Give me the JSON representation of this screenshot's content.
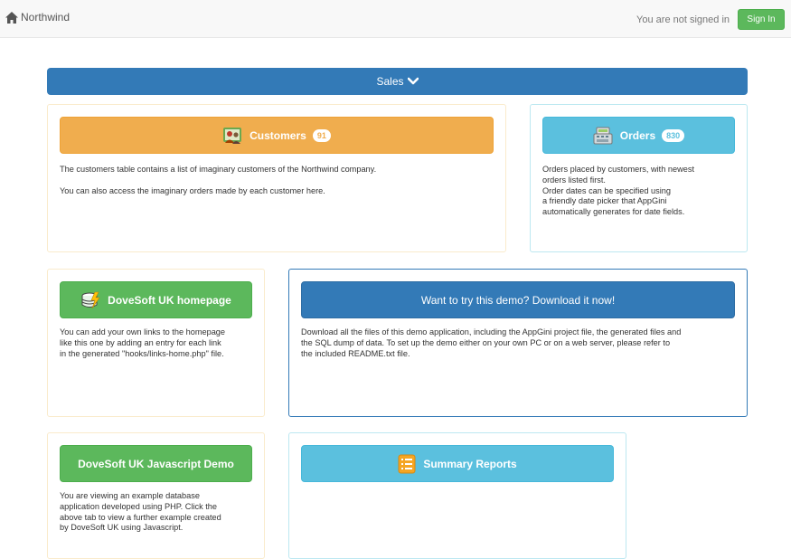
{
  "navbar": {
    "brand": "Northwind",
    "signed_status": "You are not signed in",
    "signin_label": "Sign In"
  },
  "sales": {
    "label": "Sales"
  },
  "customers": {
    "label": "Customers",
    "count": "91",
    "desc1": "The customers table contains a list of imaginary customers of the Northwind company.",
    "desc2": "You can also access the imaginary orders made by each customer here."
  },
  "orders": {
    "label": "Orders",
    "count": "830",
    "lines": [
      "Orders placed by customers, with newest",
      "orders listed first.",
      "Order dates can be specified using",
      "a friendly date picker that AppGini",
      "automatically generates for date fields."
    ]
  },
  "dovesoft_home": {
    "label": "DoveSoft UK homepage",
    "lines": [
      "You can add your own links to the homepage",
      "like this one by adding an entry for each link",
      "in the generated \"hooks/links-home.php\" file."
    ]
  },
  "download": {
    "label": "Want to try this demo? Download it now!",
    "lines": [
      "Download all the files of this demo application, including the AppGini project file, the generated files and",
      "the SQL dump of data. To set up the demo either on your own PC or on a web server, please refer to",
      "the included README.txt file."
    ]
  },
  "js_demo": {
    "label": "DoveSoft UK Javascript Demo",
    "lines": [
      "You are viewing an example database",
      "application developed using PHP. Click the",
      "above tab to view a further example created",
      "by DoveSoft UK using Javascript."
    ]
  },
  "summary": {
    "label": "Summary Reports"
  },
  "colors": {
    "primary": "#337ab7",
    "warning": "#f0ad4e",
    "info": "#5bc0de",
    "success": "#5cb85c"
  },
  "icons": [
    "home-icon",
    "chevron-down-icon",
    "customers-icon",
    "register-icon",
    "database-icon",
    "list-icon"
  ]
}
